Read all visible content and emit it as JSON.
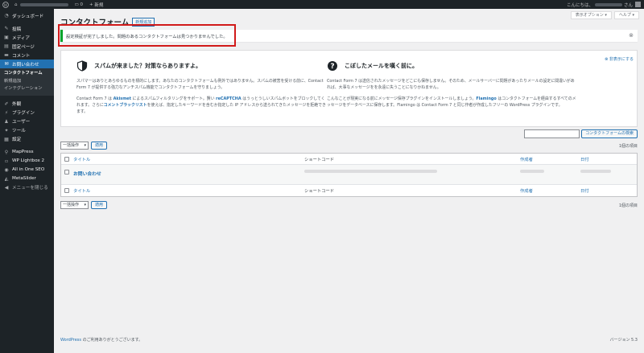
{
  "admin_bar": {
    "wp_icon": "wordpress-icon",
    "comments_count": "0",
    "new_label": "新規",
    "greeting": "こんにちは、",
    "greeting_suffix": "さん"
  },
  "sidebar": {
    "items": [
      {
        "label": "ダッシュボード",
        "icon": "dashboard-icon"
      },
      {
        "label": "投稿",
        "icon": "pin-icon"
      },
      {
        "label": "メディア",
        "icon": "media-icon"
      },
      {
        "label": "固定ページ",
        "icon": "page-icon"
      },
      {
        "label": "コメント",
        "icon": "comment-icon"
      },
      {
        "label": "お問い合わせ",
        "icon": "mail-icon"
      },
      {
        "label": "外観",
        "icon": "brush-icon"
      },
      {
        "label": "プラグイン",
        "icon": "plugin-icon"
      },
      {
        "label": "ユーザー",
        "icon": "user-icon"
      },
      {
        "label": "ツール",
        "icon": "wrench-icon"
      },
      {
        "label": "設定",
        "icon": "settings-icon"
      },
      {
        "label": "MapPress",
        "icon": "map-pin-icon"
      },
      {
        "label": "WP Lightbox 2",
        "icon": "lightbox-icon"
      },
      {
        "label": "All in One SEO",
        "icon": "seo-icon"
      },
      {
        "label": "MetaSlider",
        "icon": "slider-icon"
      },
      {
        "label": "メニューを閉じる",
        "icon": "collapse-icon"
      }
    ],
    "submenu": [
      "コンタクトフォーム",
      "新規追加",
      "インテグレーション"
    ]
  },
  "header": {
    "screen_options": "表示オプション ▾",
    "help": "ヘルプ ▾",
    "title": "コンタクトフォーム",
    "add_new": "新規追加"
  },
  "notice": {
    "text": "設定検証が完了しました。問題のあるコンタクトフォームは見つかりませんでした。"
  },
  "welcome": {
    "hide_link": "⊗ 非表示にする",
    "left": {
      "title": "スパムが来ました？対策ならありますよ。",
      "p1": "スパマーはありとあらゆるものを標的にします。あなたのコンタクトフォームも例外ではありません。スパムの被害を受ける前に、Contact Form 7 が提供する強力なアンチスパム機能でコンタクトフォームを守りましょう。",
      "p2a": "Contact Form 7 は ",
      "akismet": "Akismet",
      "p2b": " によるスパムフィルタリングをサポート。賢い ",
      "recaptcha": "reCAPTCHA",
      "p2c": " はうっとうしいスパムボットをブロックしてくれます。さらに",
      "blacklist": "コメントブラックリスト",
      "p2d": "を使えば、指定したキーワードを含むか指定した IP アドレスから送られてきたメッセージを拒絶できます。"
    },
    "right": {
      "title": "こぼしたメールを嘆く前に。",
      "p1": "Contact Form 7 は送信されたメッセージをどこにも保存しません。そのため、メールサーバーに問題があったりメールの設定に間違いがあれば、大事なメッセージをを永遠に失うことになりかねません。",
      "p2a": "こんなことが現実になる前にメッセージ保存プラグインをインストールしましょう。",
      "flamingo": "Flamingo",
      "p2b": " はコンタクトフォームを経由するすべてのメッセージをデータベースに保存します。Flamingo は Contact Form 7 と同じ作者が作成したフリーの WordPress プラグインです。"
    }
  },
  "search": {
    "placeholder": "",
    "button": "コンタクトフォームの検索"
  },
  "bulk": {
    "select_label": "一括操作",
    "apply": "適用",
    "count": "1個の項目"
  },
  "table": {
    "headers": {
      "title": "タイトル",
      "shortcode": "ショートコード",
      "author": "作成者",
      "date": "日付"
    },
    "rows": [
      {
        "title": "お問い合わせ"
      }
    ]
  },
  "footer": {
    "link": "WordPress",
    "text": " のご利用ありがとうございます。",
    "version": "バージョン 5.3"
  }
}
